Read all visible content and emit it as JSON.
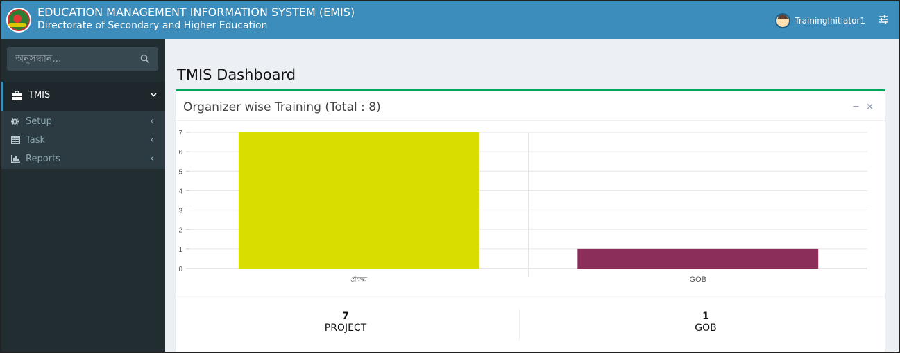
{
  "header": {
    "title": "EDUCATION MANAGEMENT INFORMATION SYSTEM (EMIS)",
    "subtitle": "Directorate of Secondary and Higher Education",
    "user_name": "TrainingInitiator1"
  },
  "sidebar": {
    "search_placeholder": "অনুসন্ধান...",
    "active_item": {
      "label": "TMIS",
      "icon": "briefcase-icon"
    },
    "items": [
      {
        "label": "Setup",
        "icon": "gear-icon"
      },
      {
        "label": "Task",
        "icon": "task-icon"
      },
      {
        "label": "Reports",
        "icon": "bar-chart-icon"
      }
    ]
  },
  "main": {
    "page_title": "TMIS Dashboard",
    "box_title": "Organizer wise Training (Total : 8)",
    "collapse_label": "−",
    "close_label": "×",
    "stats": [
      {
        "value": "7",
        "label": "PROJECT"
      },
      {
        "value": "1",
        "label": "GOB"
      }
    ]
  },
  "chart_data": {
    "type": "bar",
    "categories": [
      "প্রকল্প",
      "GOB"
    ],
    "values": [
      7,
      1
    ],
    "colors": [
      "#d9dd00",
      "#8b2e5a"
    ],
    "ylim": [
      0,
      7
    ],
    "yticks": [
      0,
      1,
      2,
      3,
      4,
      5,
      6,
      7
    ],
    "grid": true
  },
  "colors": {
    "header": "#3c8dbc",
    "sidebar": "#222d32",
    "box_accent": "#00a65a"
  }
}
